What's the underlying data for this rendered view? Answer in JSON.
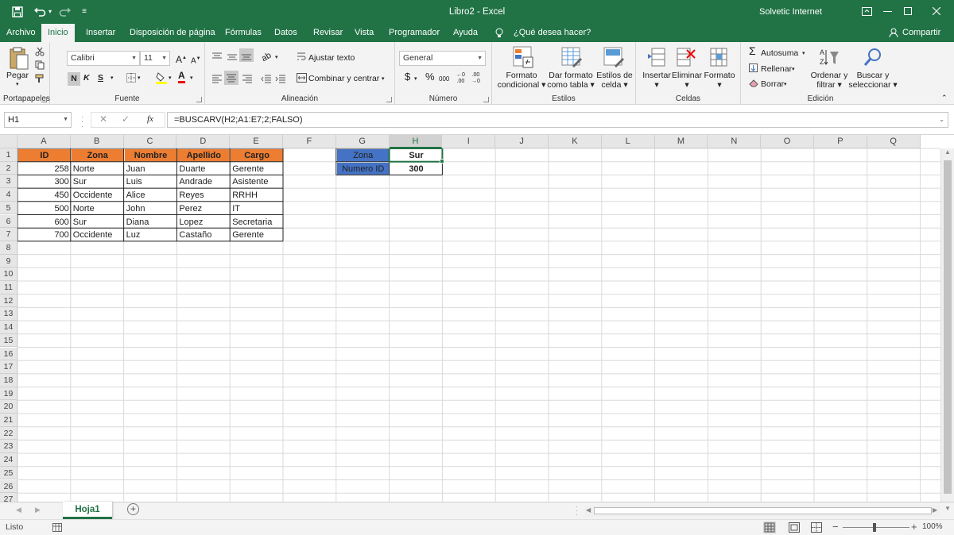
{
  "titlebar": {
    "title": "Libro2  -  Excel",
    "user": "Solvetic Internet",
    "save_icon": "save-icon",
    "undo_icon": "undo-icon",
    "redo_icon": "redo-icon"
  },
  "tabs": [
    "Archivo",
    "Inicio",
    "Insertar",
    "Disposición de página",
    "Fórmulas",
    "Datos",
    "Revisar",
    "Vista",
    "Programador",
    "Ayuda"
  ],
  "tell_me": "¿Qué desea hacer?",
  "share": "Compartir",
  "ribbon": {
    "clipboard": {
      "paste": "Pegar",
      "label": "Portapapeles"
    },
    "font": {
      "name": "Calibri",
      "size": "11",
      "bold": "N",
      "italic": "K",
      "underline": "S",
      "label": "Fuente"
    },
    "alignment": {
      "wrap": "Ajustar texto",
      "merge": "Combinar y centrar",
      "label": "Alineación"
    },
    "number": {
      "format": "General",
      "currency": "$",
      "percent": "%",
      "thousands": "000",
      "label": "Número"
    },
    "styles": {
      "conditional": [
        "Formato",
        "condicional"
      ],
      "table": [
        "Dar formato",
        "como tabla"
      ],
      "cell_styles": [
        "Estilos de",
        "celda"
      ],
      "label": "Estilos"
    },
    "cells": {
      "insert": "Insertar",
      "delete": "Eliminar",
      "format": "Formato",
      "label": "Celdas"
    },
    "editing": {
      "autosum": "Autosuma",
      "fill": "Rellenar",
      "clear": "Borrar",
      "sort": [
        "Ordenar y",
        "filtrar"
      ],
      "find": [
        "Buscar y",
        "seleccionar"
      ],
      "label": "Edición"
    }
  },
  "formula_bar": {
    "name_box": "H1",
    "fx": "fx",
    "formula": "=BUSCARV(H2;A1:E7;2;FALSO)"
  },
  "columns": [
    "A",
    "B",
    "C",
    "D",
    "E",
    "F",
    "G",
    "H",
    "I",
    "J",
    "K",
    "L",
    "M",
    "N",
    "O",
    "P",
    "Q"
  ],
  "rows": [
    "1",
    "2",
    "3",
    "4",
    "5",
    "6",
    "7",
    "8",
    "9",
    "10",
    "11",
    "12",
    "13",
    "14",
    "15",
    "16",
    "17",
    "18",
    "19",
    "20",
    "21",
    "22",
    "23",
    "24",
    "25",
    "26",
    "27"
  ],
  "table": {
    "headers": [
      "ID",
      "Zona",
      "Nombre",
      "Apellido",
      "Cargo"
    ],
    "rows": [
      [
        "258",
        "Norte",
        "Juan",
        "Duarte",
        "Gerente"
      ],
      [
        "300",
        "Sur",
        "Luis",
        "Andrade",
        "Asistente"
      ],
      [
        "450",
        "Occidente",
        "Alice",
        "Reyes",
        "RRHH"
      ],
      [
        "500",
        "Norte",
        "John",
        "Perez",
        "IT"
      ],
      [
        "600",
        "Sur",
        "Diana",
        "Lopez",
        "Secretaria"
      ],
      [
        "700",
        "Occidente",
        "Luz",
        "Castaño",
        "Gerente"
      ]
    ]
  },
  "lookup": {
    "zona_label": "Zona",
    "zona_value": "Sur",
    "id_label": "Numero ID",
    "id_value": "300"
  },
  "sheet_tab": "Hoja1",
  "status": {
    "ready": "Listo",
    "zoom": "100%"
  },
  "colors": {
    "excel_green": "#217346",
    "header_orange": "#ed7d31",
    "label_blue": "#4472c4"
  }
}
